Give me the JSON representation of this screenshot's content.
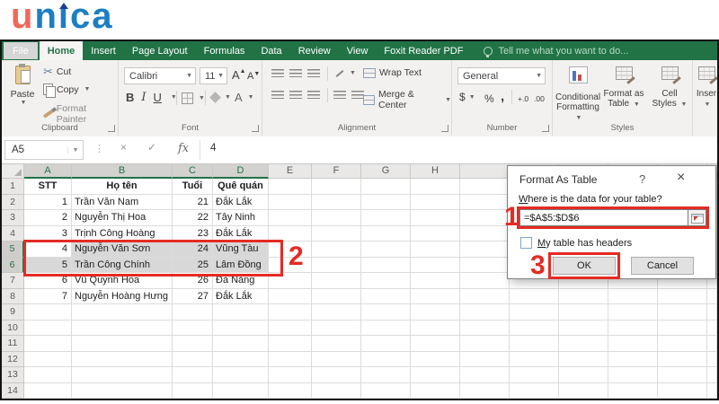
{
  "logo": {
    "text": "unica"
  },
  "tabbar": {
    "tabs": [
      {
        "label": "File",
        "style": "file"
      },
      {
        "label": "Home",
        "style": "active"
      },
      {
        "label": "Insert"
      },
      {
        "label": "Page Layout"
      },
      {
        "label": "Formulas"
      },
      {
        "label": "Data"
      },
      {
        "label": "Review"
      },
      {
        "label": "View"
      },
      {
        "label": "Foxit Reader PDF"
      }
    ],
    "tell_me": "Tell me what you want to do..."
  },
  "ribbon": {
    "clipboard": {
      "group_label": "Clipboard",
      "paste": "Paste",
      "cut": "Cut",
      "copy": "Copy",
      "format_painter": "Format Painter"
    },
    "font": {
      "group_label": "Font",
      "family": "Calibri",
      "size": "11",
      "bold": "B",
      "italic": "I",
      "underline": "U",
      "grow": "A",
      "shrink": "A",
      "color": "A"
    },
    "alignment": {
      "group_label": "Alignment",
      "wrap_text": "Wrap Text",
      "merge_center": "Merge & Center"
    },
    "number": {
      "group_label": "Number",
      "format": "General",
      "currency": "$",
      "percent": "%",
      "comma": ",",
      "inc_decimal": "+.0",
      "dec_decimal": ".00"
    },
    "styles": {
      "group_label": "Styles",
      "conditional_1": "Conditional",
      "conditional_2": "Formatting",
      "format_table_1": "Format as",
      "format_table_2": "Table",
      "cell_styles_1": "Cell",
      "cell_styles_2": "Styles"
    },
    "cells": {
      "insert": "Inser"
    }
  },
  "formula_bar": {
    "name_box": "A5",
    "fx": "fx",
    "value": "4"
  },
  "sheet": {
    "visible_columns": [
      "A",
      "B",
      "C",
      "D",
      "E",
      "F",
      "G",
      "H"
    ],
    "row_count": 14,
    "header_row": [
      "STT",
      "Họ tên",
      "Tuổi",
      "Quê quán"
    ],
    "records": [
      [
        "1",
        "Trần Văn Nam",
        "21",
        "Đắk Lắk"
      ],
      [
        "2",
        "Nguyễn Thị Hoa",
        "22",
        "Tây Ninh"
      ],
      [
        "3",
        "Trịnh Công Hoàng",
        "23",
        "Đắk Lắk"
      ],
      [
        "4",
        "Nguyễn Văn Sơn",
        "24",
        "Vũng Tàu"
      ],
      [
        "5",
        "Trần Công Chính",
        "25",
        "Lâm Đồng"
      ],
      [
        "6",
        "Vũ Quỳnh Hoa",
        "26",
        "Đà Nẵng"
      ],
      [
        "7",
        "Nguyễn Hoàng Hưng",
        "27",
        "Đắk Lắk"
      ]
    ],
    "selected_rows": [
      5,
      6
    ],
    "selected_columns": [
      "A",
      "B",
      "C",
      "D"
    ],
    "active_cell": "A5"
  },
  "dialog": {
    "title": "Format As Table",
    "help_button": "?",
    "close_button": "×",
    "prompt": "Where is the data for your table?",
    "range_value": "=$A$5:$D$6",
    "checkbox_label": "My table has headers",
    "checkbox_checked": false,
    "ok_button": "OK",
    "cancel_button": "Cancel"
  },
  "annotations": {
    "step1": "1",
    "step2": "2",
    "step3": "3"
  },
  "colors": {
    "excel_green": "#217346",
    "annotation_red": "#e42b23",
    "logo_orange": "#f0685a",
    "logo_blue": "#1b7fc3",
    "selection_gray": "#d8d8d8"
  }
}
